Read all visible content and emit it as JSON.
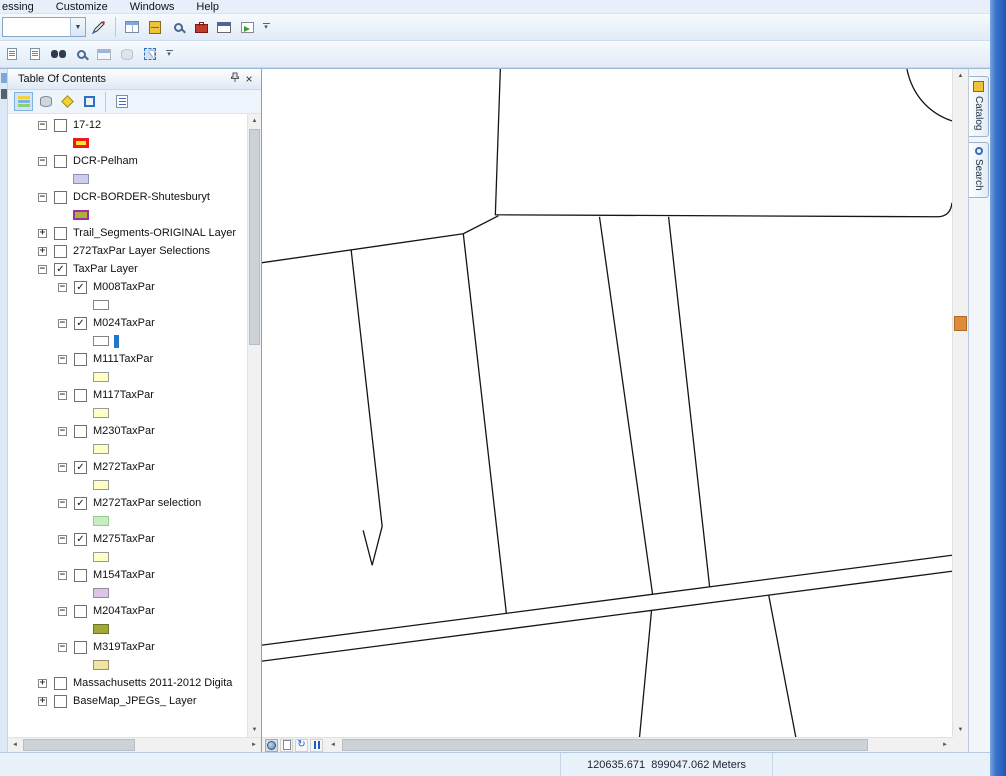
{
  "menu": {
    "items": [
      "essing",
      "Customize",
      "Windows",
      "Help"
    ]
  },
  "icons": {
    "overflow": "▾",
    "combo_arrow": "▼",
    "up": "▲",
    "down": "▼",
    "left": "◄",
    "right": "►",
    "close": "×",
    "refresh": "↻"
  },
  "toolbar1": {
    "combo_value": ""
  },
  "toc": {
    "title": "Table Of Contents",
    "tree": [
      {
        "label": "17-12",
        "exp": "−",
        "check": "",
        "swatch": {
          "fill": "#ffe81e",
          "border": "#f01818",
          "bw": "3px"
        }
      },
      {
        "label": "DCR-Pelham",
        "exp": "−",
        "check": "",
        "swatch": {
          "fill": "#ccccee",
          "border": "#9090b0",
          "bw": "1px"
        }
      },
      {
        "label": "DCR-BORDER-Shutesburyt",
        "exp": "−",
        "check": "",
        "swatch": {
          "fill": "#aab038",
          "border": "#a030a0",
          "bw": "2px"
        }
      },
      {
        "label": "Trail_Segments-ORIGINAL Layer",
        "exp": "+",
        "check": ""
      },
      {
        "label": "272TaxPar Layer Selections",
        "exp": "+",
        "check": ""
      },
      {
        "label": "TaxPar Layer",
        "exp": "−",
        "check": "✓"
      },
      {
        "label": "M008TaxPar",
        "exp": "−",
        "check": "✓",
        "swatch": {
          "fill": "#ffffff",
          "border": "#858585",
          "bw": "1px"
        }
      },
      {
        "label": "M024TaxPar",
        "exp": "−",
        "check": "✓",
        "swatch": {
          "fill": "#ffffff",
          "border": "#858585",
          "bw": "1px"
        },
        "swatch2": {
          "fill": "#2277cc"
        }
      },
      {
        "label": "M111TaxPar",
        "exp": "−",
        "check": "",
        "swatch": {
          "fill": "#ffffc4",
          "border": "#999999",
          "bw": "1px"
        }
      },
      {
        "label": "M117TaxPar",
        "exp": "−",
        "check": "",
        "swatch": {
          "fill": "#ffffc4",
          "border": "#999999",
          "bw": "1px"
        }
      },
      {
        "label": "M230TaxPar",
        "exp": "−",
        "check": "",
        "swatch": {
          "fill": "#ffffc4",
          "border": "#999999",
          "bw": "1px"
        }
      },
      {
        "label": "M272TaxPar",
        "exp": "−",
        "check": "✓",
        "swatch": {
          "fill": "#ffffc4",
          "border": "#999999",
          "bw": "1px"
        }
      },
      {
        "label": "M272TaxPar selection",
        "exp": "−",
        "check": "✓",
        "swatch": {
          "fill": "#c6eec0",
          "border": "#9cc896",
          "bw": "1px"
        }
      },
      {
        "label": "M275TaxPar",
        "exp": "−",
        "check": "✓",
        "swatch": {
          "fill": "#ffffc4",
          "border": "#999999",
          "bw": "1px"
        }
      },
      {
        "label": "M154TaxPar",
        "exp": "−",
        "check": "",
        "swatch": {
          "fill": "#dec4e6",
          "border": "#958a9a",
          "bw": "1px"
        }
      },
      {
        "label": "M204TaxPar",
        "exp": "−",
        "check": "",
        "swatch": {
          "fill": "#a4a838",
          "border": "#6e7226",
          "bw": "1px"
        }
      },
      {
        "label": "M319TaxPar",
        "exp": "−",
        "check": "",
        "swatch": {
          "fill": "#eee6a0",
          "border": "#97906a",
          "bw": "1px"
        }
      },
      {
        "label": "Massachusetts 2011-2012 Digita",
        "exp": "+",
        "check": ""
      },
      {
        "label": "BaseMap_JPEGs_ Layer",
        "exp": "+",
        "check": ""
      }
    ]
  },
  "side_tabs": [
    {
      "label": "Catalog"
    },
    {
      "label": "Search"
    }
  ],
  "statusbar": {
    "coordinates": "120635.671  899047.062 Meters"
  }
}
